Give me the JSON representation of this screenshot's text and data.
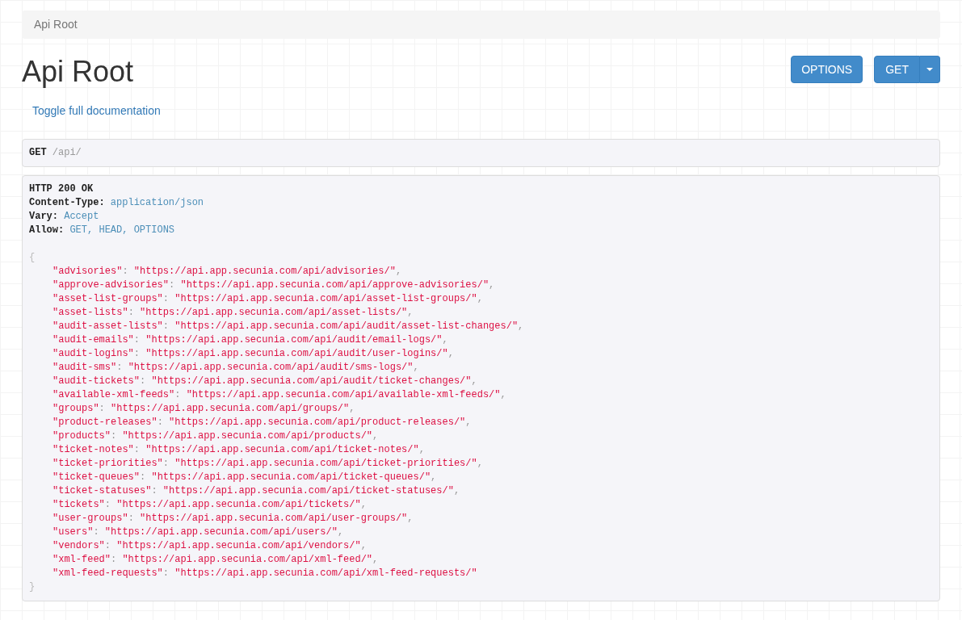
{
  "breadcrumb": [
    {
      "label": "Api Root",
      "active": true
    }
  ],
  "title": "Api Root",
  "buttons": [
    {
      "label": "OPTIONS",
      "kind": "plain"
    },
    {
      "label": "GET",
      "kind": "split"
    }
  ],
  "toggle_link": "Toggle full documentation",
  "request": {
    "method": "GET",
    "path": "/api/"
  },
  "response": {
    "status_line": "HTTP 200 OK",
    "headers": [
      {
        "name": "Content-Type:",
        "value": "application/json"
      },
      {
        "name": "Vary:",
        "value": "Accept"
      },
      {
        "name": "Allow:",
        "value": "GET, HEAD, OPTIONS"
      }
    ],
    "open_brace": "{",
    "entries": [
      {
        "key": "\"advisories\"",
        "colon": ":",
        "value": "\"https://api.app.secunia.com/api/advisories/\"",
        "comma": ","
      },
      {
        "key": "\"approve-advisories\"",
        "colon": ":",
        "value": "\"https://api.app.secunia.com/api/approve-advisories/\"",
        "comma": ","
      },
      {
        "key": "\"asset-list-groups\"",
        "colon": ":",
        "value": "\"https://api.app.secunia.com/api/asset-list-groups/\"",
        "comma": ","
      },
      {
        "key": "\"asset-lists\"",
        "colon": ":",
        "value": "\"https://api.app.secunia.com/api/asset-lists/\"",
        "comma": ","
      },
      {
        "key": "\"audit-asset-lists\"",
        "colon": ":",
        "value": "\"https://api.app.secunia.com/api/audit/asset-list-changes/\"",
        "comma": ","
      },
      {
        "key": "\"audit-emails\"",
        "colon": ":",
        "value": "\"https://api.app.secunia.com/api/audit/email-logs/\"",
        "comma": ","
      },
      {
        "key": "\"audit-logins\"",
        "colon": ":",
        "value": "\"https://api.app.secunia.com/api/audit/user-logins/\"",
        "comma": ","
      },
      {
        "key": "\"audit-sms\"",
        "colon": ":",
        "value": "\"https://api.app.secunia.com/api/audit/sms-logs/\"",
        "comma": ","
      },
      {
        "key": "\"audit-tickets\"",
        "colon": ":",
        "value": "\"https://api.app.secunia.com/api/audit/ticket-changes/\"",
        "comma": ","
      },
      {
        "key": "\"available-xml-feeds\"",
        "colon": ":",
        "value": "\"https://api.app.secunia.com/api/available-xml-feeds/\"",
        "comma": ","
      },
      {
        "key": "\"groups\"",
        "colon": ":",
        "value": "\"https://api.app.secunia.com/api/groups/\"",
        "comma": ","
      },
      {
        "key": "\"product-releases\"",
        "colon": ":",
        "value": "\"https://api.app.secunia.com/api/product-releases/\"",
        "comma": ","
      },
      {
        "key": "\"products\"",
        "colon": ":",
        "value": "\"https://api.app.secunia.com/api/products/\"",
        "comma": ","
      },
      {
        "key": "\"ticket-notes\"",
        "colon": ":",
        "value": "\"https://api.app.secunia.com/api/ticket-notes/\"",
        "comma": ","
      },
      {
        "key": "\"ticket-priorities\"",
        "colon": ":",
        "value": "\"https://api.app.secunia.com/api/ticket-priorities/\"",
        "comma": ","
      },
      {
        "key": "\"ticket-queues\"",
        "colon": ":",
        "value": "\"https://api.app.secunia.com/api/ticket-queues/\"",
        "comma": ","
      },
      {
        "key": "\"ticket-statuses\"",
        "colon": ":",
        "value": "\"https://api.app.secunia.com/api/ticket-statuses/\"",
        "comma": ","
      },
      {
        "key": "\"tickets\"",
        "colon": ":",
        "value": "\"https://api.app.secunia.com/api/tickets/\"",
        "comma": ","
      },
      {
        "key": "\"user-groups\"",
        "colon": ":",
        "value": "\"https://api.app.secunia.com/api/user-groups/\"",
        "comma": ","
      },
      {
        "key": "\"users\"",
        "colon": ":",
        "value": "\"https://api.app.secunia.com/api/users/\"",
        "comma": ","
      },
      {
        "key": "\"vendors\"",
        "colon": ":",
        "value": "\"https://api.app.secunia.com/api/vendors/\"",
        "comma": ","
      },
      {
        "key": "\"xml-feed\"",
        "colon": ":",
        "value": "\"https://api.app.secunia.com/api/xml-feed/\"",
        "comma": ","
      },
      {
        "key": "\"xml-feed-requests\"",
        "colon": ":",
        "value": "\"https://api.app.secunia.com/api/xml-feed-requests/\""
      }
    ],
    "close_brace": "}"
  }
}
